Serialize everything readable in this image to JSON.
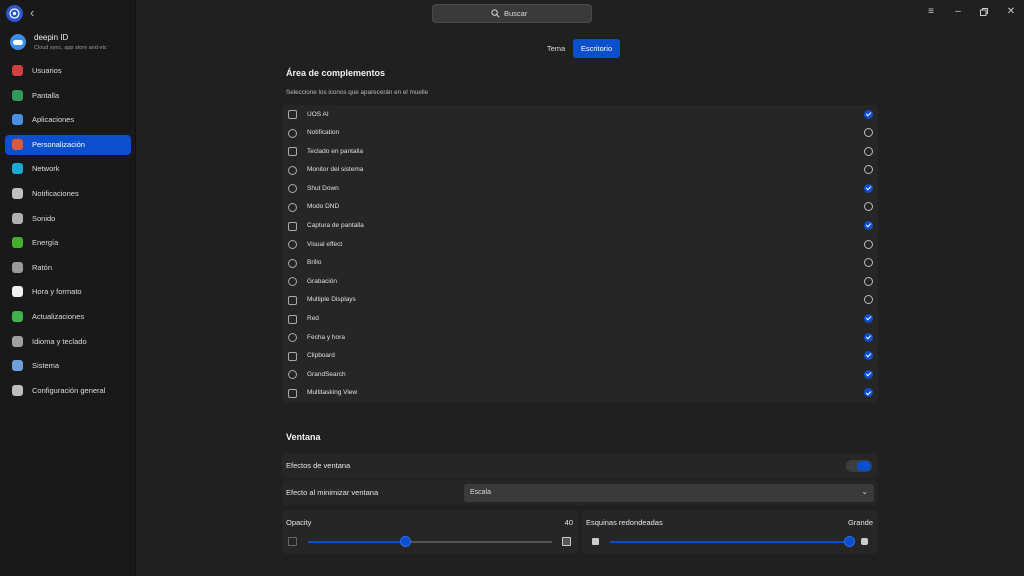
{
  "sidebar": {
    "account": {
      "name": "deepin ID",
      "subtitle": "Cloud sync, app store and etc"
    },
    "items": [
      {
        "label": "Usuarios",
        "icon": "user-icon",
        "color": "#d04040"
      },
      {
        "label": "Pantalla",
        "icon": "display-icon",
        "color": "#2f9a5a"
      },
      {
        "label": "Aplicaciones",
        "icon": "apps-icon",
        "color": "#4a90e2"
      },
      {
        "label": "Personalización",
        "icon": "palette-icon",
        "color": "#e05a3a"
      },
      {
        "label": "Network",
        "icon": "network-icon",
        "color": "#1aaad4"
      },
      {
        "label": "Notificaciones",
        "icon": "bell-icon",
        "color": "#c0c0c0"
      },
      {
        "label": "Sonido",
        "icon": "speaker-icon",
        "color": "#b0b0b0"
      },
      {
        "label": "Energía",
        "icon": "battery-icon",
        "color": "#43b02a"
      },
      {
        "label": "Ratón",
        "icon": "mouse-icon",
        "color": "#9a9a9a"
      },
      {
        "label": "Hora y formato",
        "icon": "clock-icon",
        "color": "#f0f0f0"
      },
      {
        "label": "Actualizaciones",
        "icon": "update-icon",
        "color": "#3fb34f"
      },
      {
        "label": "Idioma y teclado",
        "icon": "keyboard-icon",
        "color": "#a0a0a0"
      },
      {
        "label": "Sistema",
        "icon": "system-icon",
        "color": "#6fa0d8"
      },
      {
        "label": "Configuración general",
        "icon": "settings-icon",
        "color": "#bdbdbd"
      }
    ],
    "active_index": 3
  },
  "titlebar": {
    "search_label": "Buscar"
  },
  "tabs": [
    {
      "label": "Tema",
      "active": false
    },
    {
      "label": "Escritorio",
      "active": true
    }
  ],
  "plugins": {
    "title": "Área de complementos",
    "subtitle": "Seleccione los iconos que aparecerán en el muelle",
    "items": [
      {
        "label": "UOS AI",
        "icon": "ai-icon",
        "checked": true
      },
      {
        "label": "Notification",
        "icon": "bell-icon",
        "checked": false
      },
      {
        "label": "Teclado en pantalla",
        "icon": "keyboard-icon",
        "checked": false
      },
      {
        "label": "Monitor del sistema",
        "icon": "monitor-icon",
        "checked": false
      },
      {
        "label": "Shut Down",
        "icon": "power-icon",
        "checked": true
      },
      {
        "label": "Modo DND",
        "icon": "moon-icon",
        "checked": false
      },
      {
        "label": "Captura de pantalla",
        "icon": "screenshot-icon",
        "checked": true
      },
      {
        "label": "Visual effect",
        "icon": "visual-effect-icon",
        "checked": false
      },
      {
        "label": "Brillo",
        "icon": "brightness-icon",
        "checked": false
      },
      {
        "label": "Grabación",
        "icon": "record-icon",
        "checked": false
      },
      {
        "label": "Multiple Displays",
        "icon": "multi-display-icon",
        "checked": false
      },
      {
        "label": "Red",
        "icon": "wifi-icon",
        "checked": true
      },
      {
        "label": "Fecha y hora",
        "icon": "clock-icon",
        "checked": true
      },
      {
        "label": "Clipboard",
        "icon": "clipboard-icon",
        "checked": true
      },
      {
        "label": "GrandSearch",
        "icon": "search-icon",
        "checked": true
      },
      {
        "label": "Multitasking View",
        "icon": "multitask-icon",
        "checked": true
      }
    ]
  },
  "window": {
    "title": "Ventana",
    "effects_label": "Efectos de ventana",
    "effects_on": true,
    "minimize_label": "Efecto al minimizar ventana",
    "minimize_value": "Escala",
    "opacity_label": "Opacity",
    "opacity_value": "40",
    "opacity_fraction": 0.4,
    "corners_label": "Esquinas redondeadas",
    "corners_value": "Grande",
    "corners_fraction": 1.0
  },
  "colors": {
    "accent": "#0b4fcf"
  }
}
